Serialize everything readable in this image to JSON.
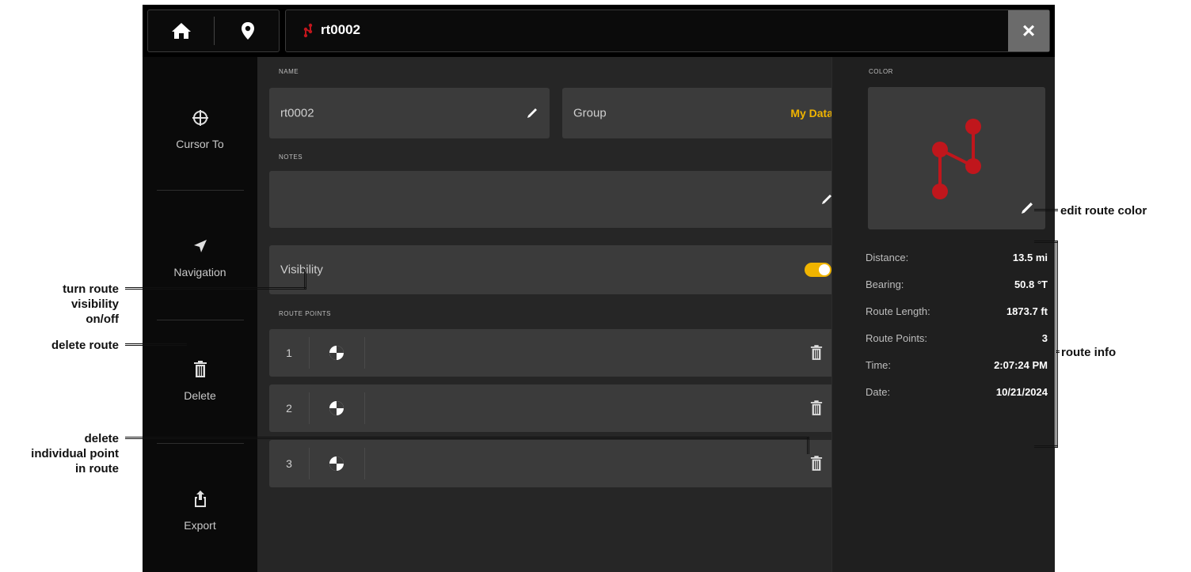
{
  "topbar": {
    "home_icon": "home-icon",
    "location_icon": "location-pin-icon",
    "route_title": "rt0002",
    "close_label": "×"
  },
  "sidebar": {
    "items": [
      {
        "label": "Cursor To",
        "icon": "crosshair-icon"
      },
      {
        "label": "Navigation",
        "icon": "navigation-arrow-icon"
      },
      {
        "label": "Delete",
        "icon": "trash-icon"
      },
      {
        "label": "Export",
        "icon": "export-icon"
      }
    ]
  },
  "form": {
    "name_label": "NAME",
    "name_value": "rt0002",
    "group_label": "Group",
    "group_value": "My Data",
    "notes_label": "NOTES",
    "notes_value": "",
    "visibility_label": "Visibility",
    "visibility_on": true,
    "route_points_label": "ROUTE POINTS"
  },
  "route_points": [
    {
      "number": "1"
    },
    {
      "number": "2"
    },
    {
      "number": "3"
    }
  ],
  "right_panel": {
    "color_label": "COLOR",
    "route_color": "#c0161c",
    "info": [
      {
        "key": "Distance:",
        "value": "13.5 mi"
      },
      {
        "key": "Bearing:",
        "value": "50.8 °T"
      },
      {
        "key": "Route Length:",
        "value": "1873.7 ft"
      },
      {
        "key": "Route Points:",
        "value": "3"
      },
      {
        "key": "Time:",
        "value": "2:07:24 PM"
      },
      {
        "key": "Date:",
        "value": "10/21/2024"
      }
    ]
  },
  "annotations": {
    "edit_color": "edit route color",
    "route_info": "route info",
    "visibility_l1": "turn route",
    "visibility_l2": "visibility",
    "visibility_l3": "on/off",
    "delete_route": "delete route",
    "delete_point_l1": "delete",
    "delete_point_l2": "individual point",
    "delete_point_l3": "in route"
  },
  "colors": {
    "accent": "#f0b400",
    "route_red": "#c0161c",
    "panel": "#3b3b3b",
    "background": "#262626"
  }
}
